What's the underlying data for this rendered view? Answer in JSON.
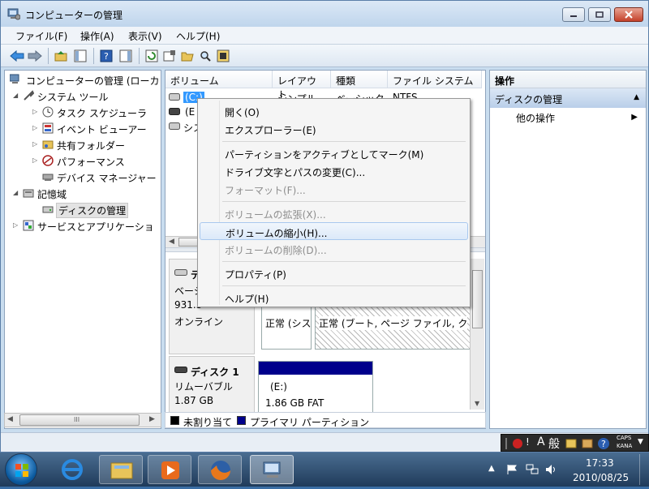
{
  "window": {
    "title": "コンピューターの管理",
    "menu": [
      "ファイル(F)",
      "操作(A)",
      "表示(V)",
      "ヘルプ(H)"
    ]
  },
  "tree": {
    "items": [
      {
        "label": "コンピューターの管理 (ローカ",
        "level": 0
      },
      {
        "label": "システム ツール",
        "level": 1
      },
      {
        "label": "タスク スケジューラ",
        "level": 2
      },
      {
        "label": "イベント ビューアー",
        "level": 2
      },
      {
        "label": "共有フォルダー",
        "level": 2
      },
      {
        "label": "パフォーマンス",
        "level": 2
      },
      {
        "label": "デバイス マネージャー",
        "level": 2
      },
      {
        "label": "記憶域",
        "level": 1
      },
      {
        "label": "ディスクの管理",
        "level": 2
      },
      {
        "label": "サービスとアプリケーショ",
        "level": 1
      }
    ],
    "scroll_label": "III"
  },
  "volumes": {
    "headers": [
      "ボリューム",
      "レイアウト",
      "種類",
      "ファイル システム"
    ],
    "rows": [
      {
        "name": "(C:)",
        "layout": "シンプル",
        "type": "ベーシック",
        "fs": "NTFS"
      },
      {
        "name": "(E",
        "layout": "",
        "type": "",
        "fs": ""
      },
      {
        "name": "シス",
        "layout": "",
        "type": "",
        "fs": ""
      }
    ]
  },
  "disks": [
    {
      "name": "デ",
      "type": "ベーシ",
      "size": "931.5",
      "state": "オンライン",
      "partitions": [
        {
          "name": "",
          "text": "正常 (シス"
        },
        {
          "name": "",
          "text": "正常 (ブート, ページ ファイル, ク"
        }
      ]
    },
    {
      "name": "ディスク 1",
      "type": "リムーバブル",
      "size": "1.87 GB",
      "partitions": [
        {
          "name": "(E:)",
          "text": "1.86 GB FAT"
        }
      ]
    }
  ],
  "legend": [
    {
      "label": "未割り当て",
      "color": "#000000"
    },
    {
      "label": "プライマリ パーティション",
      "color": "#00008b"
    }
  ],
  "actions": {
    "header": "操作",
    "section": "ディスクの管理",
    "item": "他の操作"
  },
  "context_menu": {
    "items": [
      {
        "label": "開く(O)",
        "enabled": true
      },
      {
        "label": "エクスプローラー(E)",
        "enabled": true
      },
      {
        "label": "パーティションをアクティブとしてマーク(M)",
        "enabled": true
      },
      {
        "label": "ドライブ文字とパスの変更(C)...",
        "enabled": true
      },
      {
        "label": "フォーマット(F)...",
        "enabled": false
      },
      {
        "label": "ボリュームの拡張(X)...",
        "enabled": false
      },
      {
        "label": "ボリュームの縮小(H)...",
        "enabled": true,
        "highlighted": true
      },
      {
        "label": "ボリュームの削除(D)...",
        "enabled": false
      },
      {
        "label": "プロパティ(P)",
        "enabled": true
      },
      {
        "label": "ヘルプ(H)",
        "enabled": true
      }
    ]
  },
  "ime": {
    "mode": "A",
    "dict": "般",
    "caps": "CAPS",
    "kana": "KANA"
  },
  "clock": {
    "time": "17:33",
    "date": "2010/08/25"
  },
  "colors": {
    "primary_partition": "#00008b",
    "highlight": "#dbe9f9",
    "taskbar": "#203b5a"
  }
}
